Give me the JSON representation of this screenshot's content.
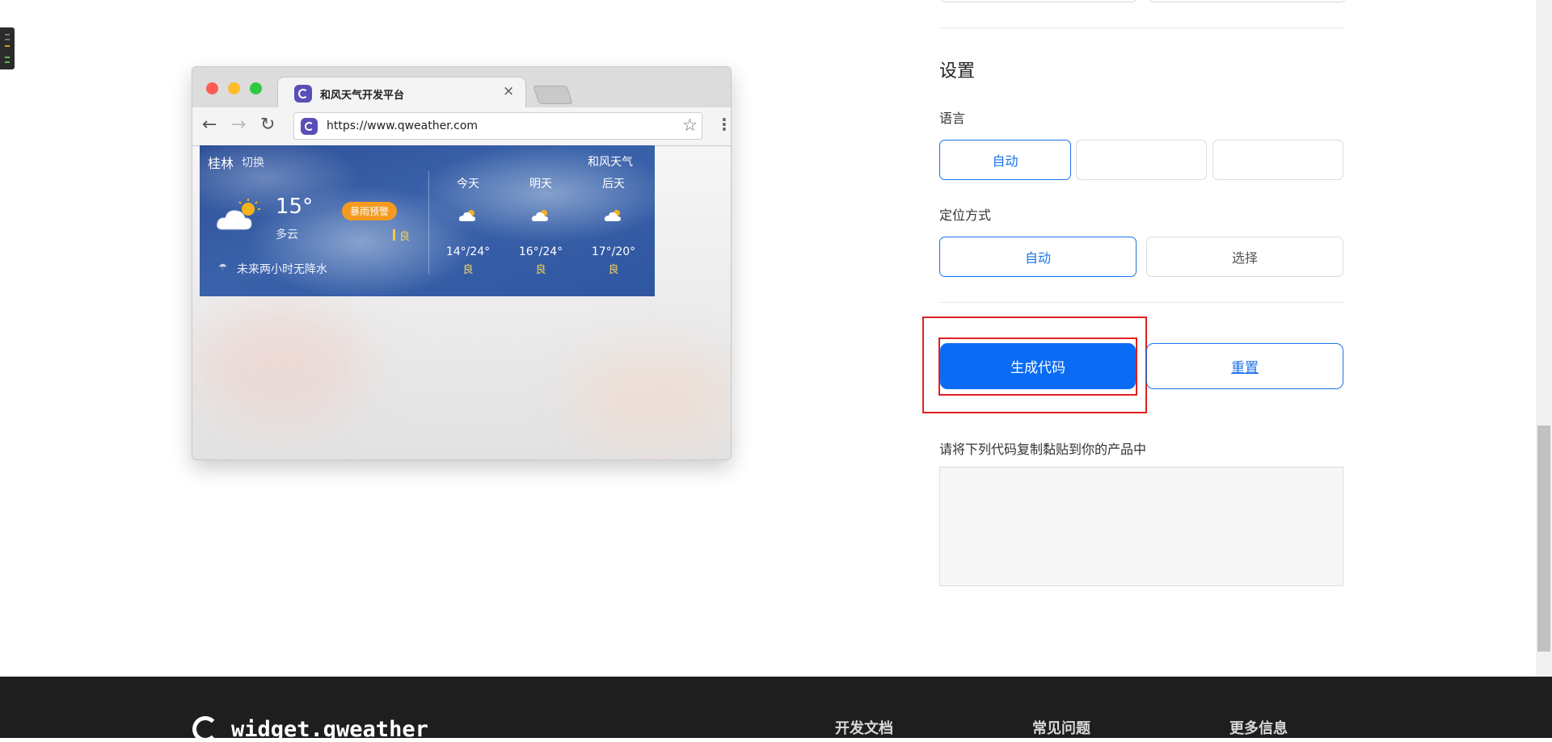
{
  "mock_browser": {
    "tab_title": "和风天气开发平台",
    "tab_close": "×",
    "url": "https://www.qweather.com",
    "back_glyph": "←",
    "forward_glyph": "→",
    "reload_glyph": "↻",
    "star_glyph": "☆",
    "menu_glyph": "⋮"
  },
  "weather_widget": {
    "city": "桂林",
    "switch": "切换",
    "brand": "和风天气",
    "temperature": "15°",
    "condition": "多云",
    "alert": "暴雨预警",
    "aqi": "良",
    "rain_note": "未来两小时无降水",
    "forecast": [
      {
        "day": "今天",
        "temp": "14°/24°",
        "aqi": "良"
      },
      {
        "day": "明天",
        "temp": "16°/24°",
        "aqi": "良"
      },
      {
        "day": "后天",
        "temp": "17°/20°",
        "aqi": "良"
      }
    ]
  },
  "settings": {
    "title": "设置",
    "language": {
      "label": "语言",
      "options": [
        "自动",
        "",
        ""
      ],
      "selected": 0
    },
    "location": {
      "label": "定位方式",
      "options": [
        "自动",
        "选择"
      ],
      "selected": 0
    },
    "generate_button": "生成代码",
    "reset_button": "重置",
    "code_prompt": "请将下列代码复制黏贴到你的产品中",
    "code_value": ""
  },
  "footer": {
    "brand": "widget.qweather",
    "columns": [
      "开发文档",
      "常见问题",
      "更多信息"
    ]
  },
  "colors": {
    "accent": "#1a73e8",
    "primary_button": "#0a6cf5",
    "highlight": "#e02020",
    "alert": "#f59a1f",
    "footer_bg": "#1e1e1e"
  }
}
